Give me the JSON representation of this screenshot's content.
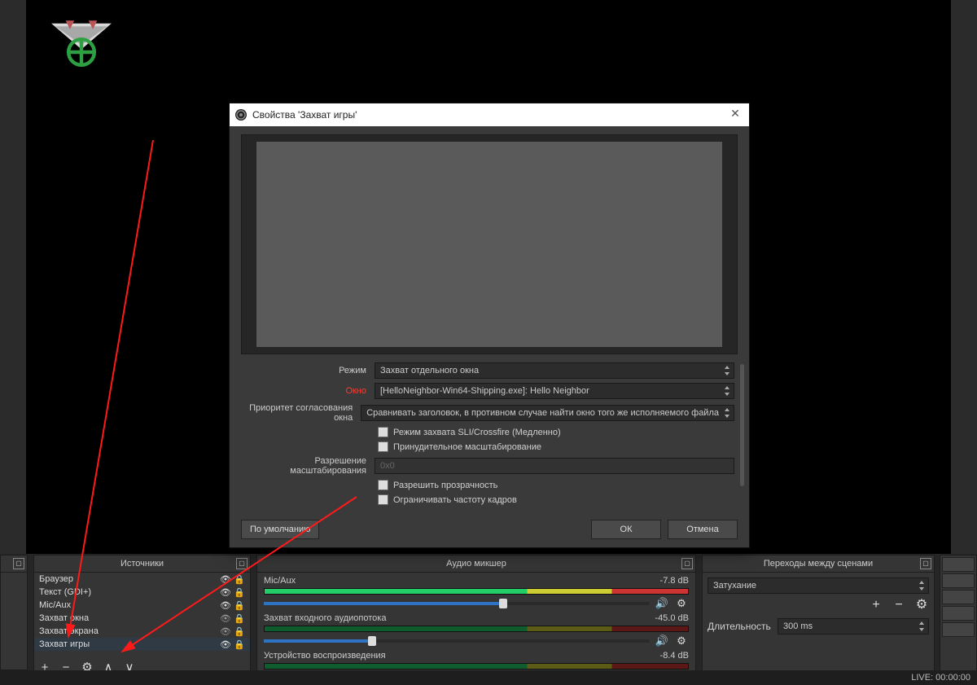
{
  "status_bar": {
    "live_text": "LIVE: 00:00:00"
  },
  "panels": {
    "sources": {
      "title": "Источники",
      "items": [
        {
          "label": "Браузер",
          "visible": true,
          "locked": true
        },
        {
          "label": "Текст (GDI+)",
          "visible": true,
          "locked": true
        },
        {
          "label": "Mic/Aux",
          "visible": true,
          "locked": true
        },
        {
          "label": "Захват окна",
          "visible": false,
          "locked": true
        },
        {
          "label": "Захват экрана",
          "visible": false,
          "locked": true
        },
        {
          "label": "Захват игры",
          "visible": true,
          "locked": true,
          "selected": true
        }
      ]
    },
    "mixer": {
      "title": "Аудио микшер",
      "channels": [
        {
          "name": "Mic/Aux",
          "db": "-7.8 dB",
          "slider_pct": 62
        },
        {
          "name": "Захват входного аудиопотока",
          "db": "-45.0 dB",
          "slider_pct": 28
        },
        {
          "name": "Устройство воспроизведения",
          "db": "-8.4 dB"
        }
      ]
    },
    "transitions": {
      "title": "Переходы между сценами",
      "effect": "Затухание",
      "duration_label": "Длительность",
      "duration_value": "300 ms"
    }
  },
  "dialog": {
    "title": "Свойства 'Захват игры'",
    "fields": {
      "mode_label": "Режим",
      "mode_value": "Захват отдельного окна",
      "window_label": "Окно",
      "window_value": "[HelloNeighbor-Win64-Shipping.exe]: Hello Neighbor",
      "priority_label": "Приоритет согласования окна",
      "priority_value": "Сравнивать заголовок, в противном случае найти окно того же исполняемого файла",
      "sli_label": "Режим захвата SLI/Crossfire (Медленно)",
      "force_scale_label": "Принудительное масштабирование",
      "resolution_label": "Разрешение масштабирования",
      "resolution_placeholder": "0x0",
      "transparency_label": "Разрешить прозрачность",
      "limit_fps_label": "Ограничивать частоту кадров"
    },
    "buttons": {
      "defaults": "По умолчанию",
      "ok": "ОК",
      "cancel": "Отмена"
    }
  }
}
